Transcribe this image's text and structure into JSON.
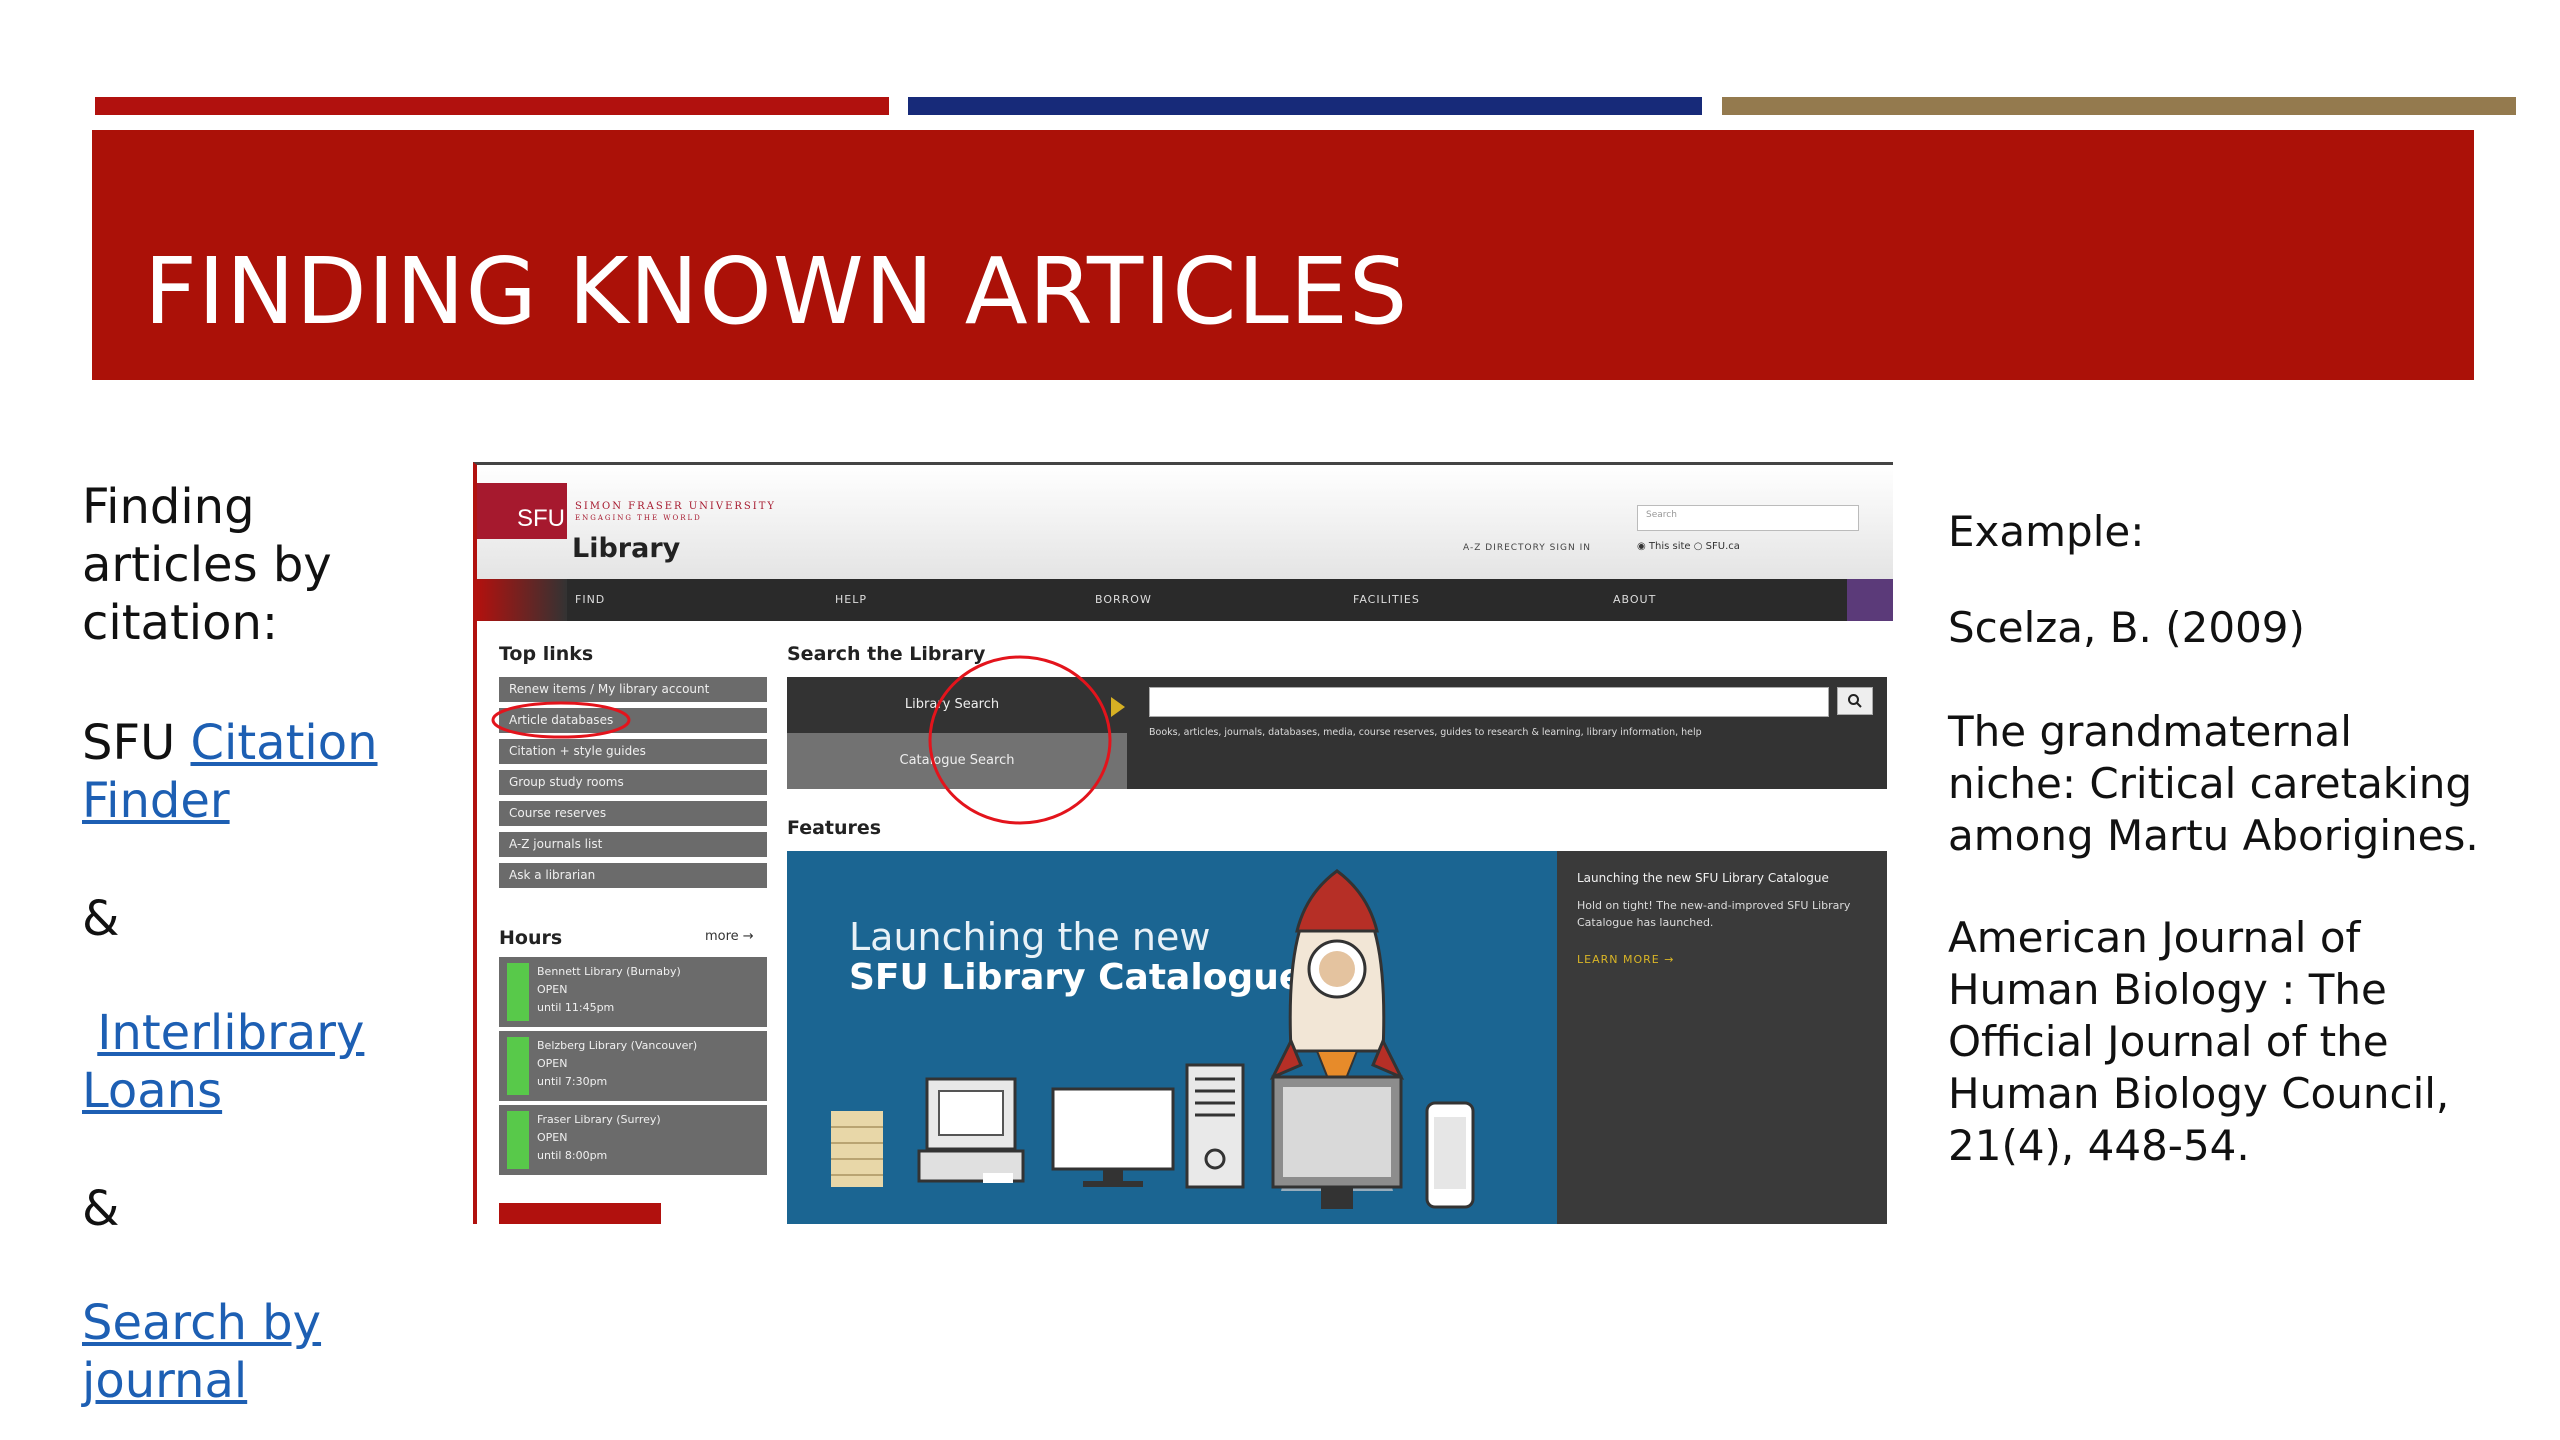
{
  "slide": {
    "title": "FINDING KNOWN ARTICLES",
    "colors": {
      "band_red": "#ab1108",
      "bar_red": "#b1110e",
      "bar_navy": "#172a79",
      "bar_tan": "#947a4e",
      "link_blue": "#1d5fb3"
    }
  },
  "left": {
    "intro": [
      "Finding",
      "articles by",
      "citation:"
    ],
    "sfu_prefix": "SFU",
    "citation_finder_1": "Citation",
    "citation_finder_2": "Finder",
    "amp1": "&",
    "interlibrary_1": "Interlibrary",
    "interlibrary_2": "Loans",
    "amp2": "&",
    "search_journal_1": "Search by",
    "search_journal_2": "journal"
  },
  "right": {
    "example_label": "Example:",
    "author": "Scelza, B. (2009)",
    "article_title": [
      "The grandmaternal",
      "niche: Critical caretaking",
      "among Martu Aborigines."
    ],
    "journal": [
      "American Journal of",
      "Human Biology : The",
      "Official Journal of the",
      "Human Biology Council,",
      "21(4), 448-54."
    ]
  },
  "screenshot": {
    "logo": "SFU",
    "university": "SIMON FRASER UNIVERSITY",
    "tagline": "ENGAGING THE WORLD",
    "library": "Library",
    "util_links": "A-Z DIRECTORY    SIGN IN",
    "search_placeholder": "Search",
    "radio_options": "◉ This site  ○ SFU.ca",
    "nav": [
      "FIND",
      "HELP",
      "BORROW",
      "FACILITIES",
      "ABOUT"
    ],
    "top_links_heading": "Top links",
    "top_links": [
      "Renew items / My library account",
      "Article databases",
      "Citation + style guides",
      "Group study rooms",
      "Course reserves",
      "A-Z journals list",
      "Ask a librarian"
    ],
    "hours_heading": "Hours",
    "hours_more": "more →",
    "hours": [
      {
        "name": "Bennett Library (Burnaby)",
        "status": "OPEN",
        "until": "until 11:45pm"
      },
      {
        "name": "Belzberg Library (Vancouver)",
        "status": "OPEN",
        "until": "until 7:30pm"
      },
      {
        "name": "Fraser Library (Surrey)",
        "status": "OPEN",
        "until": "until 8:00pm"
      }
    ],
    "search_heading": "Search the Library",
    "tab_library_search": "Library Search",
    "tab_catalogue_search": "Catalogue Search",
    "search_hint": "Books, articles, journals, databases, media, course reserves, guides to research & learning, library information, help",
    "search_button_icon": "magnifier-icon",
    "features_heading": "Features",
    "banner_line1": "Launching the new",
    "banner_line2": "SFU Library Catalogue",
    "news_title": "Launching the new SFU Library Catalogue",
    "news_body": "Hold on tight! The new-and-improved SFU Library Catalogue has launched.",
    "news_more": "LEARN MORE →",
    "highlight_color": "#e3141c"
  }
}
